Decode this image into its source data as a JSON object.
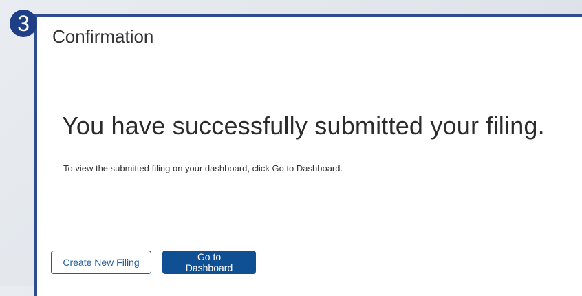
{
  "step_badge": "3",
  "page": {
    "title": "Confirmation",
    "headline": "You have successfully submitted your filing.",
    "instruction": "To view the submitted filing on your dashboard, click Go to Dashboard."
  },
  "actions": {
    "create_new_filing": "Create New Filing",
    "go_to_dashboard": "Go to Dashboard"
  },
  "colors": {
    "frame_border": "#2f4d8d",
    "primary_button": "#0f4f93",
    "outline_button": "#1f5c99",
    "badge": "#1e3f86"
  }
}
